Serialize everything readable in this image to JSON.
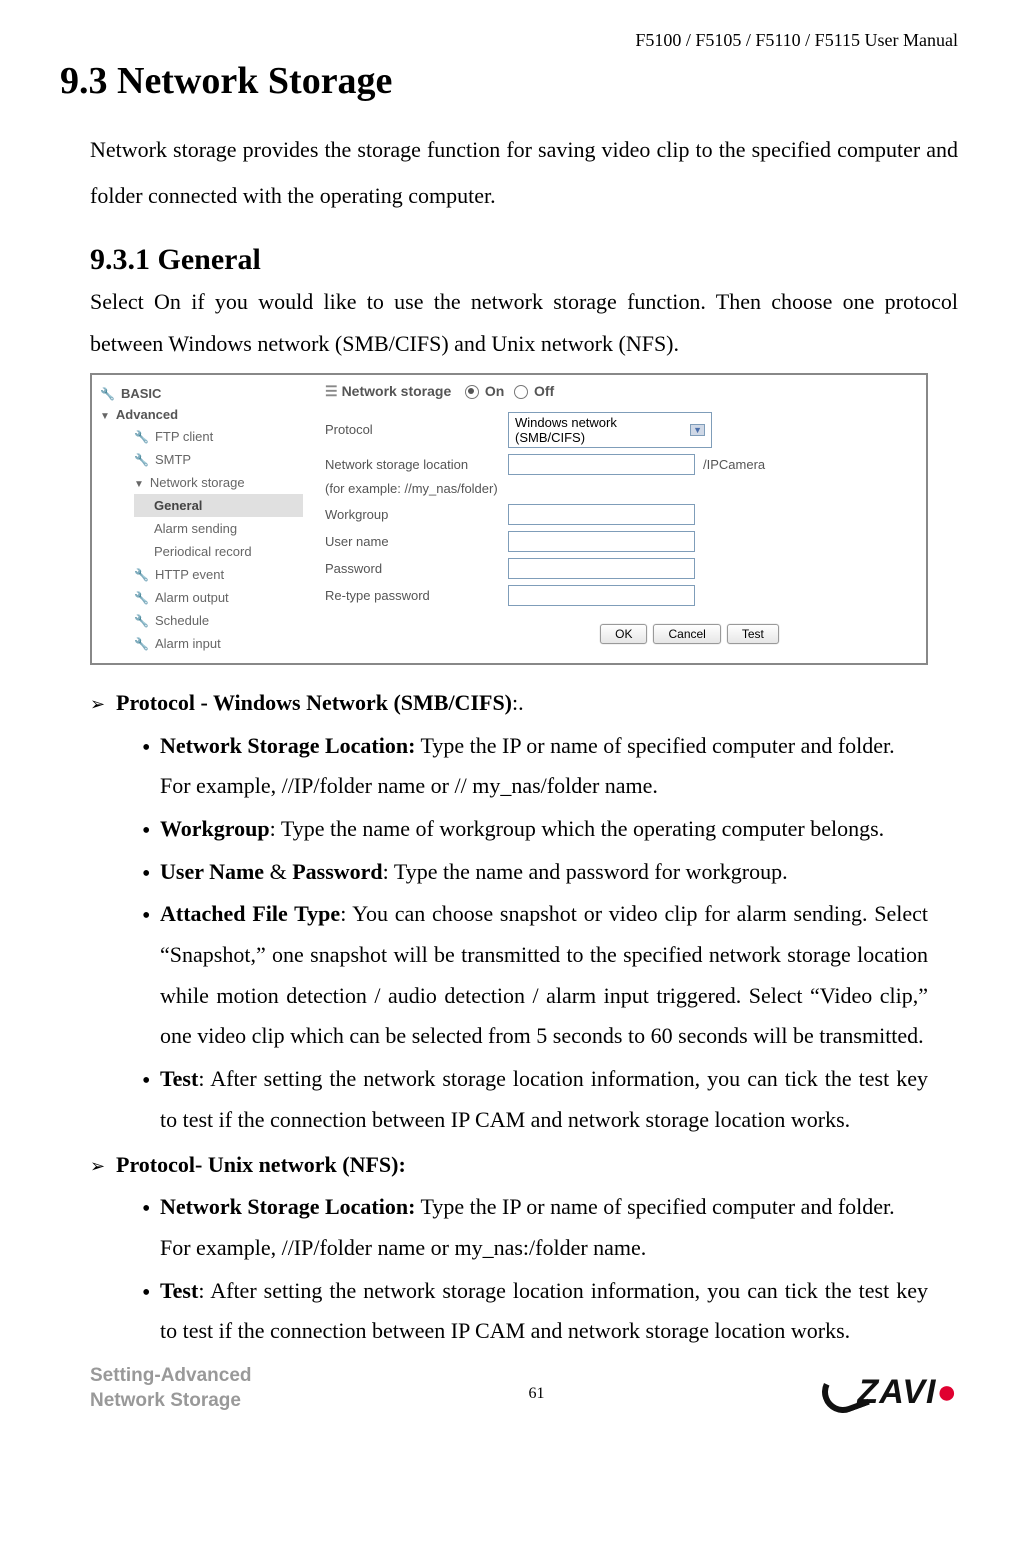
{
  "header": "F5100 / F5105 / F5110 / F5115 User Manual",
  "h1": "9.3 Network Storage",
  "p1": "Network storage provides the storage function for saving video clip to the specified computer and folder connected with the operating computer.",
  "h2": "9.3.1 General",
  "p2": "Select On if you would like to use the network storage function. Then choose one protocol between Windows network (SMB/CIFS) and Unix network (NFS).",
  "nav": {
    "basic": "BASIC",
    "advanced": "Advanced",
    "ftp": "FTP client",
    "smtp": "SMTP",
    "netstorage": "Network storage",
    "general": "General",
    "alarm": "Alarm sending",
    "period": "Periodical record",
    "http": "HTTP event",
    "aout": "Alarm output",
    "sched": "Schedule",
    "ain": "Alarm input"
  },
  "form": {
    "title": "Network storage",
    "on": "On",
    "off": "Off",
    "protocol": "Protocol",
    "protocol_val": "Windows network (SMB/CIFS)",
    "location": "Network storage location",
    "location_suffix": "/IPCamera",
    "example": "(for example: //my_nas/folder)",
    "workgroup": "Workgroup",
    "username": "User name",
    "password": "Password",
    "repass": "Re-type password",
    "ok": "OK",
    "cancel": "Cancel",
    "test": "Test"
  },
  "b": {
    "proto1_b": "Protocol - Windows Network (SMB/CIFS)",
    "proto1_t": ":.",
    "nsl_b": "Network Storage Location:",
    "nsl_t": " Type the IP or name of specified computer and folder.",
    "nsl_c": "For example, //IP/folder name or // my_nas/folder name.",
    "wg_b": "Workgroup",
    "wg_t": ": Type the name of workgroup which the operating computer belongs.",
    "up_b1": "User Name",
    "up_amp": " & ",
    "up_b2": "Password",
    "up_t": ": Type the name and password for workgroup.",
    "aft_b": "Attached File Type",
    "aft_t": ": You can choose snapshot or video clip for alarm sending. Select “Snapshot,” one snapshot will be transmitted to the specified network storage location while motion detection / audio detection / alarm input triggered. Select “Video clip,” one video clip which can be selected from 5 seconds to 60 seconds will be transmitted.",
    "test_b": "Test",
    "test_t": ": After setting the network storage location information, you can tick the test key to test if the connection between IP CAM and network storage location works.",
    "proto2_b": "Protocol- Unix network (NFS):",
    "nsl2_b": "Network Storage Location:",
    "nsl2_t": " Type the IP or name of specified computer and folder.",
    "nsl2_c": "For example, //IP/folder name or my_nas:/folder name.",
    "test2_b": "Test",
    "test2_t": ": After setting the network storage location information, you can tick the test key to test if the connection between IP CAM and network storage location works."
  },
  "footer": {
    "l1": "Setting-Advanced",
    "l2": "Network Storage",
    "page": "61",
    "logo": "ZAVI"
  }
}
